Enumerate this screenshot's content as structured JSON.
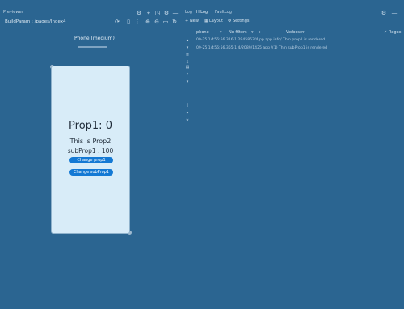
{
  "window": {
    "title": "Previewer"
  },
  "preview": {
    "path": "BuildParam : /pages/Index4",
    "device_label": "Phone (medium)"
  },
  "phone_app": {
    "prop1_text": "Prop1: 0",
    "prop2_text": "This is Prop2",
    "subprop_text": "subProp1 : 100",
    "change_prop1_label": "Change prop1",
    "change_subprop1_label": "Change subProp1"
  },
  "log_panel": {
    "tabs": [
      "Log",
      "HiLog",
      "FaultLog"
    ],
    "active_tab": "HiLog",
    "toolbar": {
      "new_label": "New",
      "layout_label": "Layout",
      "settings_label": "Settings",
      "regex_label": "Regex"
    },
    "filters": {
      "device": "phone",
      "process": "No filters",
      "level": "Verbose"
    },
    "lines": [
      "09-25 14:56:56.316 1 2945853/4/pp app info/ Thin prop1 is rendered",
      "09-25 14:56:56.355 1 4/2089/1425 app /(1) Thin subProp1 is rendered"
    ]
  }
}
